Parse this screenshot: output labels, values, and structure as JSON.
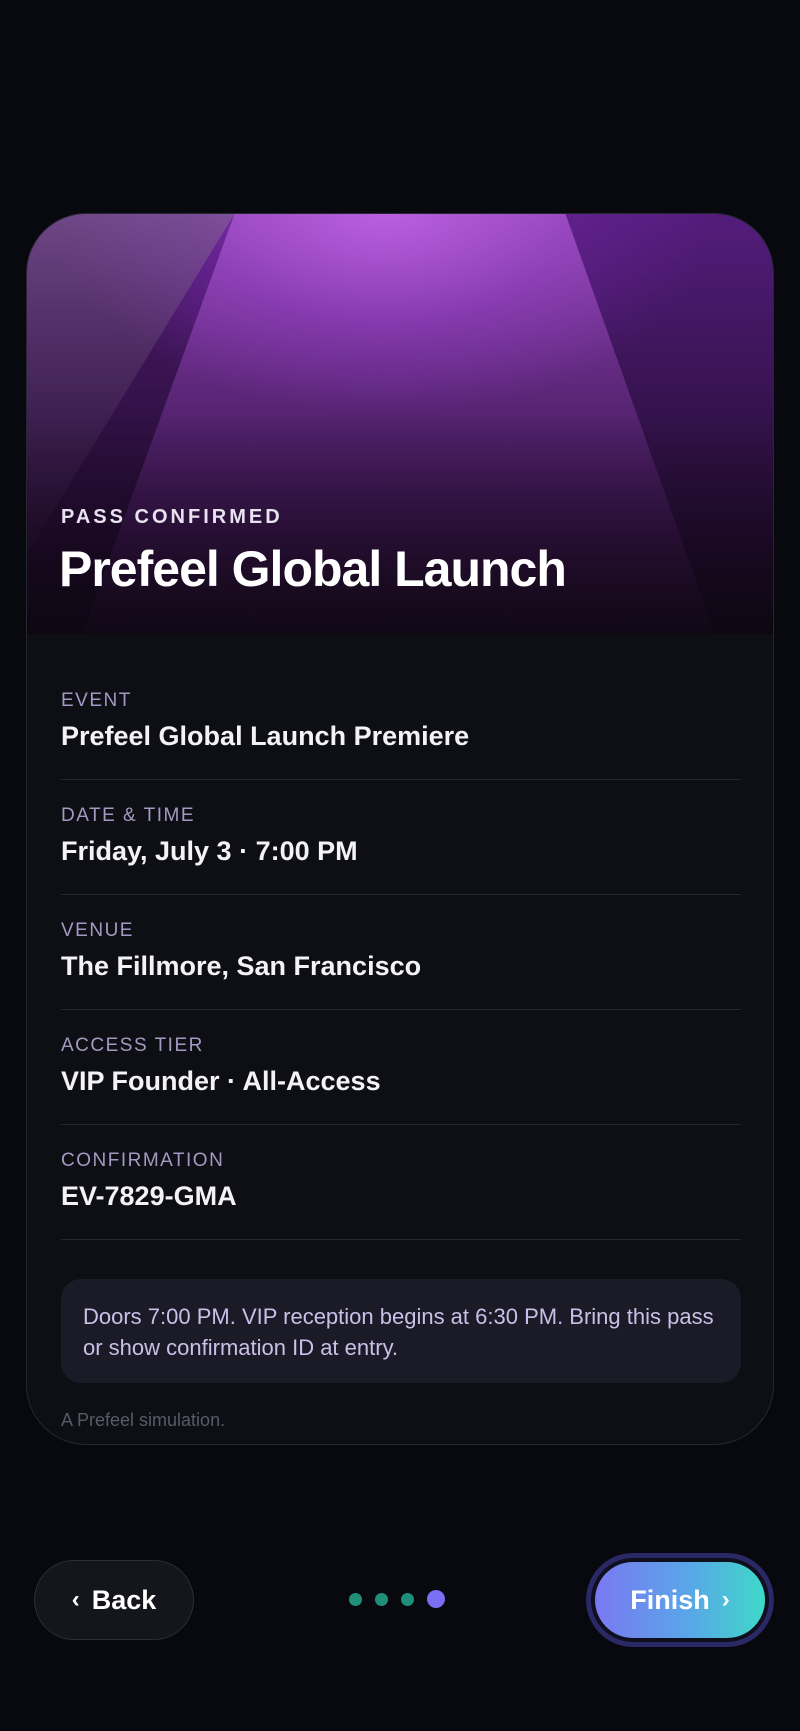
{
  "hero": {
    "kicker": "PASS CONFIRMED",
    "title": "Prefeel Global Launch"
  },
  "details": [
    {
      "label": "EVENT",
      "value": "Prefeel Global Launch Premiere"
    },
    {
      "label": "DATE & TIME",
      "value": "Friday, July 3 · 7:00 PM"
    },
    {
      "label": "VENUE",
      "value": "The Fillmore, San Francisco"
    },
    {
      "label": "ACCESS TIER",
      "value": "VIP Founder · All-Access"
    },
    {
      "label": "CONFIRMATION",
      "value": "EV-7829-GMA"
    }
  ],
  "notice": "Doors 7:00 PM. VIP reception begins at 6:30 PM. Bring this pass or show confirmation ID at entry.",
  "footnote": "A Prefeel simulation.",
  "nav": {
    "back_label": "Back",
    "finish_label": "Finish",
    "back_icon": "chevron-left-icon",
    "finish_icon": "chevron-right-icon",
    "steps_total": 4,
    "current_step": 4
  },
  "colors": {
    "accent_purple": "#7a6ef5",
    "step_dot": "#1f8f79",
    "finish_gradient_start": "#7a79f2",
    "finish_gradient_end": "#3fd9c8"
  }
}
